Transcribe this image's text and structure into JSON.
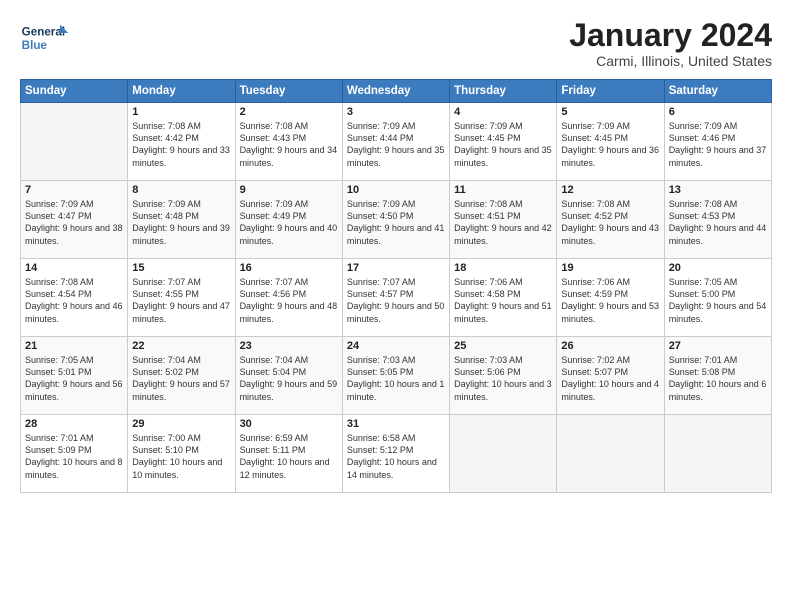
{
  "header": {
    "logo_line1": "General",
    "logo_line2": "Blue",
    "title": "January 2024",
    "subtitle": "Carmi, Illinois, United States"
  },
  "weekdays": [
    "Sunday",
    "Monday",
    "Tuesday",
    "Wednesday",
    "Thursday",
    "Friday",
    "Saturday"
  ],
  "weeks": [
    [
      {
        "day": "",
        "empty": true
      },
      {
        "day": "1",
        "sunrise": "7:08 AM",
        "sunset": "4:42 PM",
        "daylight": "9 hours and 33 minutes."
      },
      {
        "day": "2",
        "sunrise": "7:08 AM",
        "sunset": "4:43 PM",
        "daylight": "9 hours and 34 minutes."
      },
      {
        "day": "3",
        "sunrise": "7:09 AM",
        "sunset": "4:44 PM",
        "daylight": "9 hours and 35 minutes."
      },
      {
        "day": "4",
        "sunrise": "7:09 AM",
        "sunset": "4:45 PM",
        "daylight": "9 hours and 35 minutes."
      },
      {
        "day": "5",
        "sunrise": "7:09 AM",
        "sunset": "4:45 PM",
        "daylight": "9 hours and 36 minutes."
      },
      {
        "day": "6",
        "sunrise": "7:09 AM",
        "sunset": "4:46 PM",
        "daylight": "9 hours and 37 minutes."
      }
    ],
    [
      {
        "day": "7",
        "sunrise": "7:09 AM",
        "sunset": "4:47 PM",
        "daylight": "9 hours and 38 minutes."
      },
      {
        "day": "8",
        "sunrise": "7:09 AM",
        "sunset": "4:48 PM",
        "daylight": "9 hours and 39 minutes."
      },
      {
        "day": "9",
        "sunrise": "7:09 AM",
        "sunset": "4:49 PM",
        "daylight": "9 hours and 40 minutes."
      },
      {
        "day": "10",
        "sunrise": "7:09 AM",
        "sunset": "4:50 PM",
        "daylight": "9 hours and 41 minutes."
      },
      {
        "day": "11",
        "sunrise": "7:08 AM",
        "sunset": "4:51 PM",
        "daylight": "9 hours and 42 minutes."
      },
      {
        "day": "12",
        "sunrise": "7:08 AM",
        "sunset": "4:52 PM",
        "daylight": "9 hours and 43 minutes."
      },
      {
        "day": "13",
        "sunrise": "7:08 AM",
        "sunset": "4:53 PM",
        "daylight": "9 hours and 44 minutes."
      }
    ],
    [
      {
        "day": "14",
        "sunrise": "7:08 AM",
        "sunset": "4:54 PM",
        "daylight": "9 hours and 46 minutes."
      },
      {
        "day": "15",
        "sunrise": "7:07 AM",
        "sunset": "4:55 PM",
        "daylight": "9 hours and 47 minutes."
      },
      {
        "day": "16",
        "sunrise": "7:07 AM",
        "sunset": "4:56 PM",
        "daylight": "9 hours and 48 minutes."
      },
      {
        "day": "17",
        "sunrise": "7:07 AM",
        "sunset": "4:57 PM",
        "daylight": "9 hours and 50 minutes."
      },
      {
        "day": "18",
        "sunrise": "7:06 AM",
        "sunset": "4:58 PM",
        "daylight": "9 hours and 51 minutes."
      },
      {
        "day": "19",
        "sunrise": "7:06 AM",
        "sunset": "4:59 PM",
        "daylight": "9 hours and 53 minutes."
      },
      {
        "day": "20",
        "sunrise": "7:05 AM",
        "sunset": "5:00 PM",
        "daylight": "9 hours and 54 minutes."
      }
    ],
    [
      {
        "day": "21",
        "sunrise": "7:05 AM",
        "sunset": "5:01 PM",
        "daylight": "9 hours and 56 minutes."
      },
      {
        "day": "22",
        "sunrise": "7:04 AM",
        "sunset": "5:02 PM",
        "daylight": "9 hours and 57 minutes."
      },
      {
        "day": "23",
        "sunrise": "7:04 AM",
        "sunset": "5:04 PM",
        "daylight": "9 hours and 59 minutes."
      },
      {
        "day": "24",
        "sunrise": "7:03 AM",
        "sunset": "5:05 PM",
        "daylight": "10 hours and 1 minute."
      },
      {
        "day": "25",
        "sunrise": "7:03 AM",
        "sunset": "5:06 PM",
        "daylight": "10 hours and 3 minutes."
      },
      {
        "day": "26",
        "sunrise": "7:02 AM",
        "sunset": "5:07 PM",
        "daylight": "10 hours and 4 minutes."
      },
      {
        "day": "27",
        "sunrise": "7:01 AM",
        "sunset": "5:08 PM",
        "daylight": "10 hours and 6 minutes."
      }
    ],
    [
      {
        "day": "28",
        "sunrise": "7:01 AM",
        "sunset": "5:09 PM",
        "daylight": "10 hours and 8 minutes."
      },
      {
        "day": "29",
        "sunrise": "7:00 AM",
        "sunset": "5:10 PM",
        "daylight": "10 hours and 10 minutes."
      },
      {
        "day": "30",
        "sunrise": "6:59 AM",
        "sunset": "5:11 PM",
        "daylight": "10 hours and 12 minutes."
      },
      {
        "day": "31",
        "sunrise": "6:58 AM",
        "sunset": "5:12 PM",
        "daylight": "10 hours and 14 minutes."
      },
      {
        "day": "",
        "empty": true
      },
      {
        "day": "",
        "empty": true
      },
      {
        "day": "",
        "empty": true
      }
    ]
  ]
}
